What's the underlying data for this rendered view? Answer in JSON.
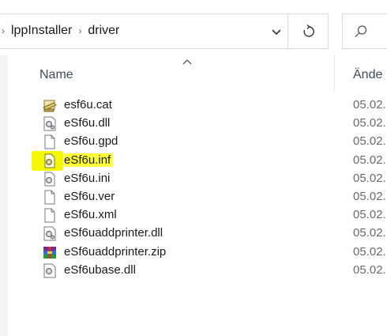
{
  "address": {
    "crumbs": [
      "lppInstaller",
      "driver"
    ]
  },
  "columns": {
    "name": "Name",
    "modified": "Ände"
  },
  "files": [
    {
      "name": "esf6u.cat",
      "date": "05.02.",
      "icon": "catalog-file-icon"
    },
    {
      "name": "eSf6u.dll",
      "date": "05.02.",
      "icon": "dll-file-icon"
    },
    {
      "name": "eSf6u.gpd",
      "date": "05.02.",
      "icon": "generic-file-icon"
    },
    {
      "name": "eSf6u.inf",
      "date": "05.02.",
      "icon": "setup-info-file-icon",
      "highlighted": true
    },
    {
      "name": "eSf6u.ini",
      "date": "05.02.",
      "icon": "config-file-icon"
    },
    {
      "name": "eSf6u.ver",
      "date": "05.02.",
      "icon": "generic-file-icon"
    },
    {
      "name": "eSf6u.xml",
      "date": "05.02.",
      "icon": "generic-file-icon"
    },
    {
      "name": "eSf6uaddprinter.dll",
      "date": "05.02.",
      "icon": "dll-file-icon"
    },
    {
      "name": "eSf6uaddprinter.zip",
      "date": "05.02.",
      "icon": "zip-archive-icon"
    },
    {
      "name": "eSf6ubase.dll",
      "date": "05.02.",
      "icon": "dll-file-icon"
    }
  ],
  "colors": {
    "highlight": "#ffff33",
    "border": "#d9d9d9"
  }
}
